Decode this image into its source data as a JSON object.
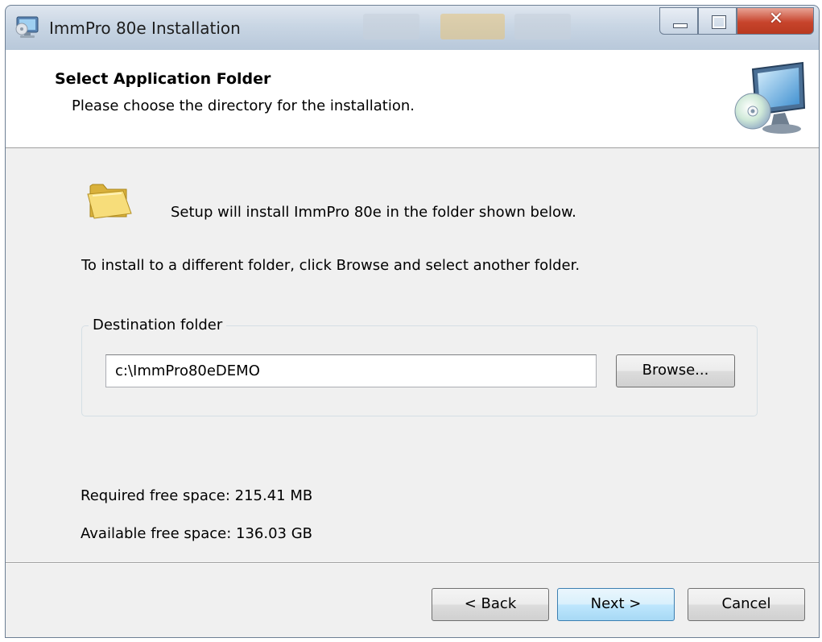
{
  "window": {
    "title": "ImmPro 80e Installation"
  },
  "header": {
    "title": "Select Application Folder",
    "subtitle": "Please choose the directory for the installation."
  },
  "body": {
    "intro": "Setup will install ImmPro 80e in the folder shown below.",
    "instruction": "To install to a different folder, click Browse and select another folder."
  },
  "destination": {
    "group_label": "Destination folder",
    "path": "c:\\ImmPro80eDEMO",
    "browse_label": "Browse..."
  },
  "space": {
    "required": "Required free space: 215.41 MB",
    "available": "Available free space: 136.03 GB"
  },
  "buttons": {
    "back": "< Back",
    "next": "Next >",
    "cancel": "Cancel"
  },
  "icons": {
    "app": "installer-monitor-icon",
    "header": "computer-disc-icon",
    "folder": "folder-icon",
    "minimize": "minimize-icon",
    "maximize": "maximize-icon",
    "close": "close-icon"
  },
  "colors": {
    "close_button": "#c7442c",
    "default_button": "#bee6fd",
    "dialog_background": "#f0f0f0"
  }
}
